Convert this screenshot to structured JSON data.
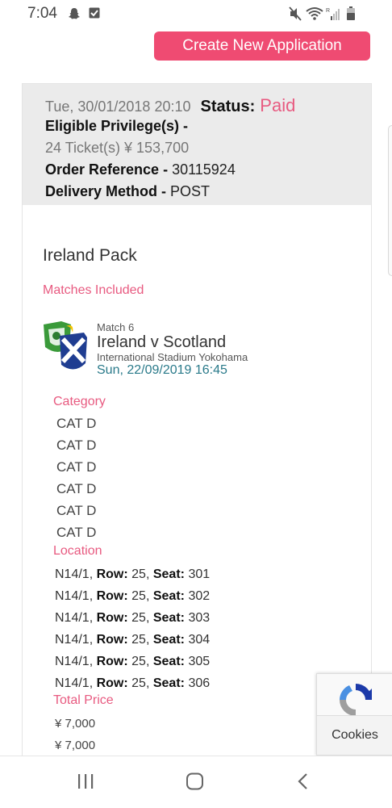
{
  "status_bar": {
    "time": "7:04"
  },
  "actions": {
    "create_label": "Create New Application"
  },
  "order": {
    "datetime": "Tue, 30/01/2018 20:10",
    "status_label": "Status:",
    "status_value": "Paid",
    "privilege_label": "Eligible Privilege(s) -",
    "privilege_value": "24 Ticket(s)  ¥ 153,700",
    "reference_label": "Order Reference -",
    "reference_value": "30115924",
    "delivery_label": "Delivery Method -",
    "delivery_value": "POST"
  },
  "pack": {
    "title": "Ireland Pack",
    "matches_heading": "Matches Included",
    "match": {
      "number": "Match 6",
      "name": "Ireland v Scotland",
      "venue": "International Stadium Yokohama",
      "date": "Sun, 22/09/2019 16:45"
    },
    "category_heading": "Category",
    "categories": [
      "CAT D",
      "CAT D",
      "CAT D",
      "CAT D",
      "CAT D",
      "CAT D"
    ],
    "location_heading": "Location",
    "row_label": "Row:",
    "seat_label": "Seat:",
    "locations": [
      {
        "block": "N14/1,",
        "row": "25,",
        "seat": "301"
      },
      {
        "block": "N14/1,",
        "row": "25,",
        "seat": "302"
      },
      {
        "block": "N14/1,",
        "row": "25,",
        "seat": "303"
      },
      {
        "block": "N14/1,",
        "row": "25,",
        "seat": "304"
      },
      {
        "block": "N14/1,",
        "row": "25,",
        "seat": "305"
      },
      {
        "block": "N14/1,",
        "row": "25,",
        "seat": "306"
      }
    ],
    "total_heading": "Total Price",
    "prices": [
      "¥ 7,000",
      "¥ 7,000"
    ]
  },
  "recaptcha": {
    "cookies_label": "Cookies"
  },
  "colors": {
    "accent": "#ef4b72",
    "status": "#e85a80",
    "date": "#2a7a8a"
  },
  "icons": [
    "snapchat-icon",
    "checkbox-icon",
    "mute-icon",
    "wifi-icon",
    "signal-icon",
    "battery-icon",
    "recent-apps-icon",
    "home-icon",
    "back-icon"
  ]
}
